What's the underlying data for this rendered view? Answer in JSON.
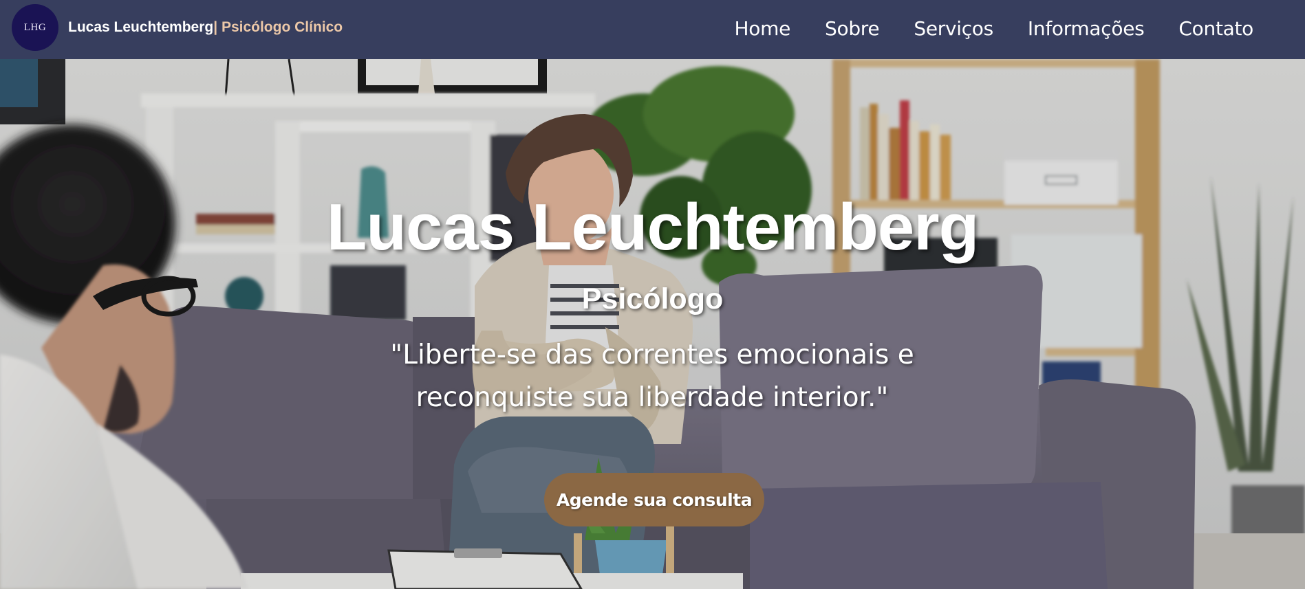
{
  "header": {
    "logo_text": "LHG",
    "brand_name": "Lucas Leuchtemberg",
    "brand_role": "| Psicólogo Clínico",
    "nav": [
      "Home",
      "Sobre",
      "Serviços",
      "Informações",
      "Contato"
    ]
  },
  "hero": {
    "title": "Lucas Leuchtemberg",
    "subtitle": "Psicólogo",
    "quote_line1": "\"Liberte-se das correntes emocionais e",
    "quote_line2": "reconquiste sua liberdade interior.\"",
    "cta_label": "Agende sua consulta"
  },
  "colors": {
    "navbar": "#373e5e",
    "logo_bg": "#1a1354",
    "brand_accent": "#ecc8a8",
    "cta": "#8b6844"
  }
}
